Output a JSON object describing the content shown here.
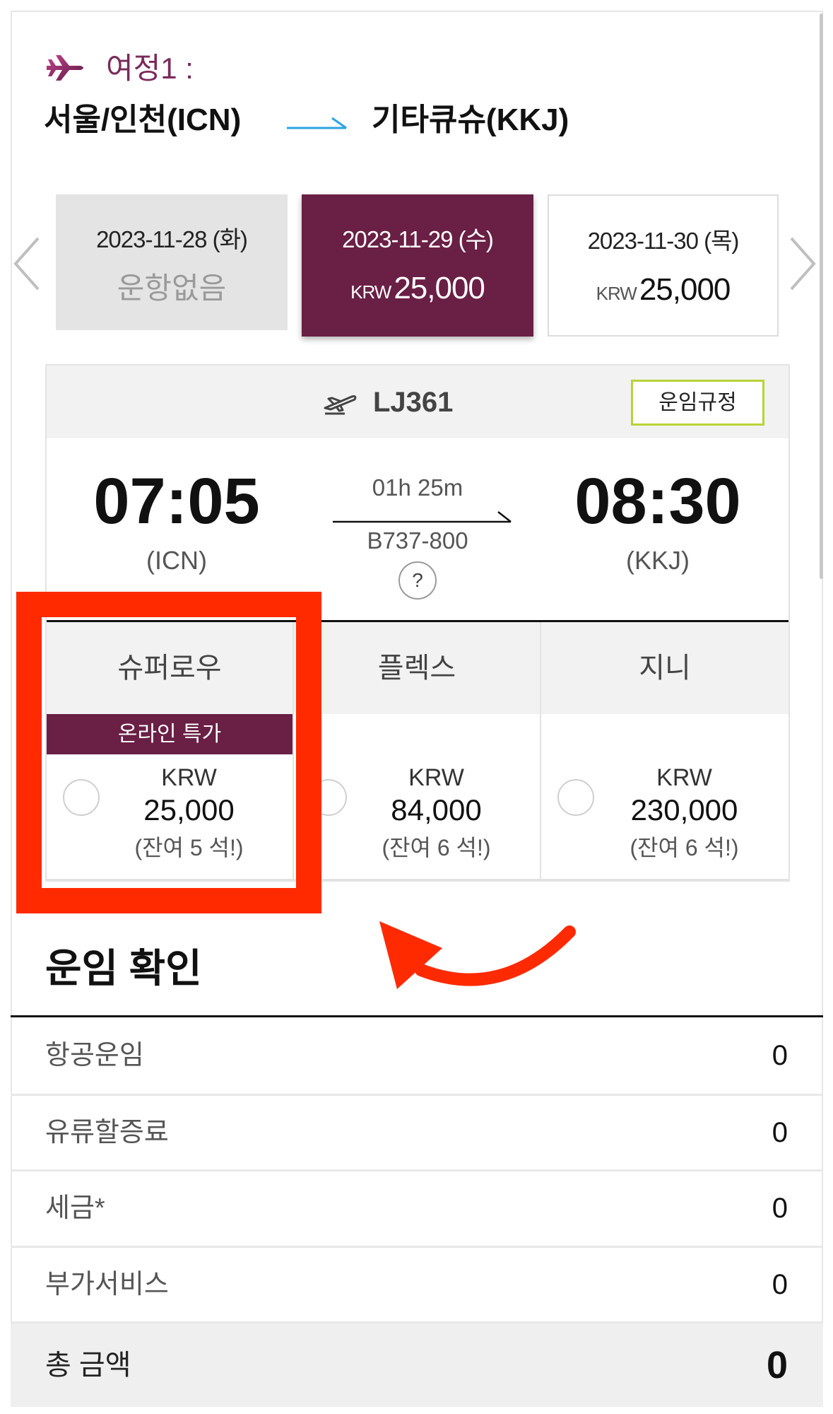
{
  "itinerary": {
    "label": "여정1 :",
    "origin": "서울/인천(ICN)",
    "destination": "기타큐슈(KKJ)"
  },
  "date_tabs": [
    {
      "date": "2023-11-28 (화)",
      "status": "운항없음",
      "selected": false
    },
    {
      "date": "2023-11-29 (수)",
      "currency": "KRW",
      "price": "25,000",
      "selected": true
    },
    {
      "date": "2023-11-30 (목)",
      "currency": "KRW",
      "price": "25,000",
      "selected": false
    }
  ],
  "flight": {
    "number": "LJ361",
    "fare_rules_label": "운임규정",
    "departure_time": "07:05",
    "departure_airport": "(ICN)",
    "duration": "01h 25m",
    "aircraft": "B737-800",
    "help_label": "?",
    "arrival_time": "08:30",
    "arrival_airport": "(KKJ)"
  },
  "fares": [
    {
      "name": "슈퍼로우",
      "badge": "온라인 특가",
      "currency": "KRW",
      "price": "25,000",
      "seats": "(잔여 5 석!)"
    },
    {
      "name": "플렉스",
      "currency": "KRW",
      "price": "84,000",
      "seats": "(잔여 6 석!)"
    },
    {
      "name": "지니",
      "currency": "KRW",
      "price": "230,000",
      "seats": "(잔여 6 석!)"
    }
  ],
  "summary": {
    "title": "운임 확인",
    "rows": [
      {
        "label": "항공운임",
        "value": "0"
      },
      {
        "label": "유류할증료",
        "value": "0"
      },
      {
        "label": "세금*",
        "value": "0"
      },
      {
        "label": "부가서비스",
        "value": "0"
      }
    ],
    "total": {
      "label": "총 금액",
      "value": "0"
    }
  },
  "colors": {
    "brand_purple": "#6a1f45",
    "itinerary_label": "#7b2a5a",
    "fare_rules_border": "#b8d339",
    "route_arrow": "#2aa4e3",
    "annotation_red": "#ff2a00"
  },
  "icons": {
    "itinerary": "airplane-icon",
    "route": "route-arrow-icon",
    "previous": "chevron-left-icon",
    "next": "chevron-right-icon",
    "flight": "departure-icon",
    "help": "question-icon",
    "annotation": "curved-arrow-icon"
  }
}
